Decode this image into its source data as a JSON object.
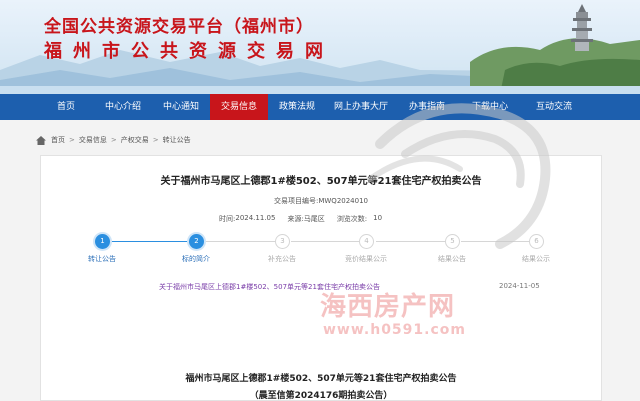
{
  "banner": {
    "title_line1": "全国公共资源交易平台（福州市）",
    "title_line2": "福州市公共资源交易网"
  },
  "nav": {
    "items": [
      {
        "label": "首页"
      },
      {
        "label": "中心介绍"
      },
      {
        "label": "中心通知"
      },
      {
        "label": "交易信息",
        "active": true
      },
      {
        "label": "政策法规"
      },
      {
        "label": "网上办事大厅"
      },
      {
        "label": "办事指南"
      },
      {
        "label": "下载中心"
      },
      {
        "label": "互动交流"
      }
    ],
    "color": "#1d5fae",
    "active_color": "#c8151b"
  },
  "breadcrumb": {
    "icon": "home-icon",
    "items": [
      "首页",
      "交易信息",
      "产权交易",
      "转让公告"
    ]
  },
  "article": {
    "title": "关于福州市马尾区上德郡1#楼502、507单元等21套住宅产权拍卖公告",
    "project_no": "交易项目编号:MWQ2024010",
    "time_label": "时间:",
    "time_value": "2024.11.05",
    "source_label": "来源:",
    "source_value": "马尾区",
    "views_label": "浏览次数:",
    "views_value": "10"
  },
  "steps": [
    {
      "num": "1",
      "label": "转让公告",
      "done": true
    },
    {
      "num": "2",
      "label": "标的简介",
      "done": true
    },
    {
      "num": "3",
      "label": "补充公告",
      "done": false
    },
    {
      "num": "4",
      "label": "竞价结果公示",
      "done": false
    },
    {
      "num": "5",
      "label": "结果公告",
      "done": false
    },
    {
      "num": "6",
      "label": "结果公示",
      "done": false
    }
  ],
  "notice": {
    "link_text": "关于福州市马尾区上德郡1#楼502、507单元等21套住宅产权拍卖公告",
    "date": "2024-11-05"
  },
  "document": {
    "title": "福州市马尾区上德郡1#楼502、507单元等21套住宅产权拍卖公告",
    "subtitle": "（晨至信第2024176期拍卖公告）"
  },
  "watermark": {
    "line1": "海西房产网",
    "line2": "www.h0591.com"
  }
}
